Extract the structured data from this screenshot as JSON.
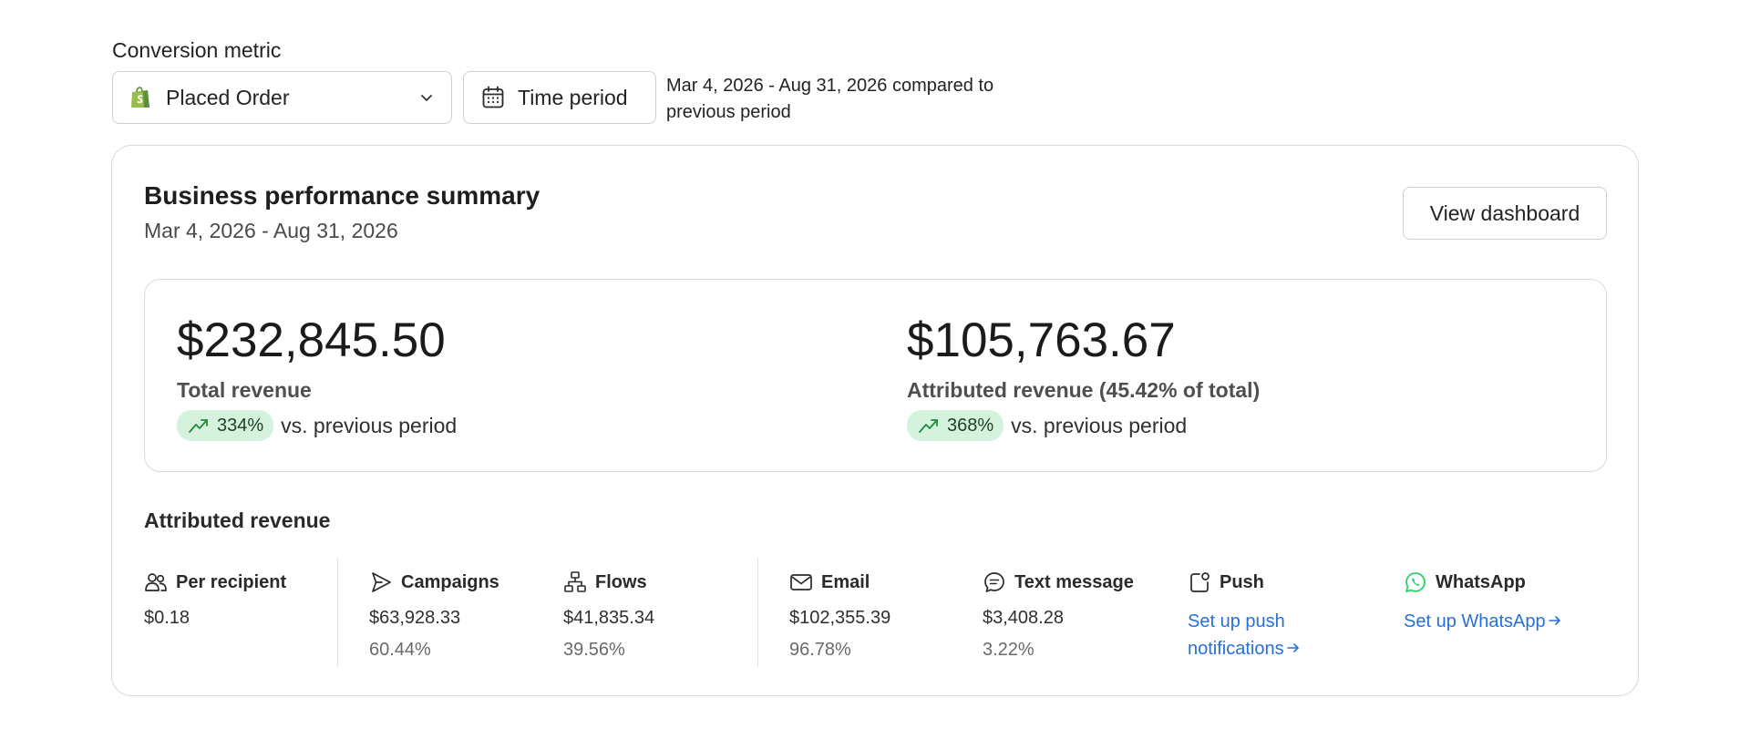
{
  "filters": {
    "conversion_metric_label": "Conversion metric",
    "selected_metric": "Placed Order",
    "selected_metric_icon": "shopify-bag-icon",
    "time_period_label": "Time period",
    "time_period_icon": "calendar-icon",
    "period_description": "Mar 4, 2026 - Aug 31, 2026 compared to previous period"
  },
  "summary": {
    "title": "Business performance summary",
    "date_range": "Mar 4, 2026 - Aug 31, 2026",
    "view_dashboard_label": "View dashboard",
    "total": {
      "value": "$232,845.50",
      "caption": "Total revenue",
      "change": "334%",
      "change_suffix": "vs. previous period"
    },
    "attributed": {
      "value": "$105,763.67",
      "caption": "Attributed revenue (45.42% of total)",
      "change": "368%",
      "change_suffix": "vs. previous period"
    }
  },
  "attributed_revenue": {
    "heading": "Attributed revenue",
    "per_recipient": {
      "label": "Per recipient",
      "value": "$0.18",
      "icon": "users-icon"
    },
    "campaigns": {
      "label": "Campaigns",
      "value": "$63,928.33",
      "pct": "60.44%",
      "icon": "send-icon"
    },
    "flows": {
      "label": "Flows",
      "value": "$41,835.34",
      "pct": "39.56%",
      "icon": "flow-icon"
    },
    "email": {
      "label": "Email",
      "value": "$102,355.39",
      "pct": "96.78%",
      "icon": "mail-icon"
    },
    "text_message": {
      "label": "Text message",
      "value": "$3,408.28",
      "pct": "3.22%",
      "icon": "chat-icon"
    },
    "push": {
      "label": "Push",
      "link": "Set up push notifications",
      "icon": "push-notification-icon"
    },
    "whatsapp": {
      "label": "WhatsApp",
      "link": "Set up WhatsApp",
      "icon": "whatsapp-icon"
    }
  },
  "colors": {
    "accent_link": "#2670d9",
    "positive_pill_bg": "#d5f3dc",
    "positive_trend": "#1f8a3b",
    "whatsapp_green": "#25d366",
    "shopify_green": "#95bf47"
  }
}
